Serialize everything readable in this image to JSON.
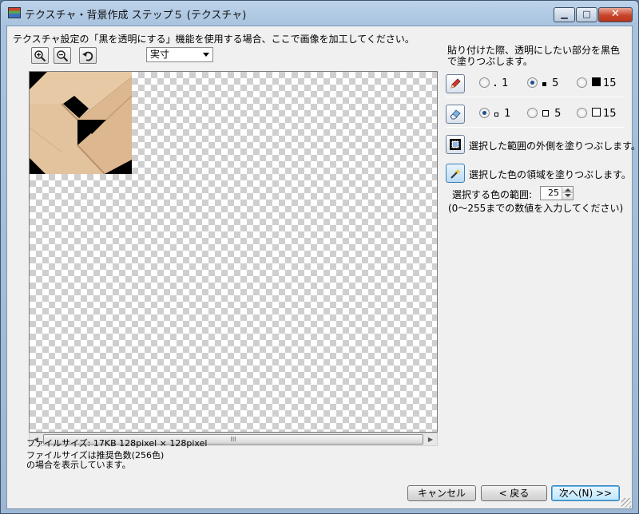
{
  "window": {
    "title": "テクスチャ・背景作成 ステップ５ (テクスチャ)",
    "controls": {
      "minimize": "▁",
      "maximize": "□",
      "close": "✕"
    }
  },
  "instruction": "テクスチャ設定の「黒を透明にする」機能を使用する場合、ここで画像を加工してください。",
  "toolbar": {
    "zoom_select_value": "実寸",
    "icons": [
      "zoom-in-icon",
      "zoom-out-icon",
      "undo-icon"
    ]
  },
  "info": {
    "file_size": "ファイルサイズ: 17KB 128pixel × 128pixel",
    "note_line1": "ファイルサイズは推奨色数(256色)",
    "note_line2": "の場合を表示しています。"
  },
  "right_panel": {
    "help_text": "貼り付けた際、透明にしたい部分を黒色で塗りつぶします。",
    "pencil": {
      "icon": "pencil-icon",
      "options": [
        {
          "label": "1",
          "selected": false
        },
        {
          "label": "5",
          "selected": true
        },
        {
          "label": "15",
          "selected": false
        }
      ]
    },
    "eraser": {
      "icon": "eraser-icon",
      "options": [
        {
          "label": "1",
          "selected": true
        },
        {
          "label": "5",
          "selected": false
        },
        {
          "label": "15",
          "selected": false
        }
      ]
    },
    "fill_outside_label": "選択した範囲の外側を塗りつぶします。",
    "fill_color_label": "選択した色の領域を塗りつぶします。",
    "color_range_label": "選択する色の範囲:",
    "color_range_value": "25",
    "color_range_hint": "(0～255までの数値を入力してください)"
  },
  "buttons": {
    "cancel": "キャンセル",
    "back": "< 戻る",
    "next": "次へ(N) >>"
  },
  "scrollbar": {
    "thumb_grip": "III",
    "left_arrow": "◀",
    "right_arrow": "▶"
  }
}
